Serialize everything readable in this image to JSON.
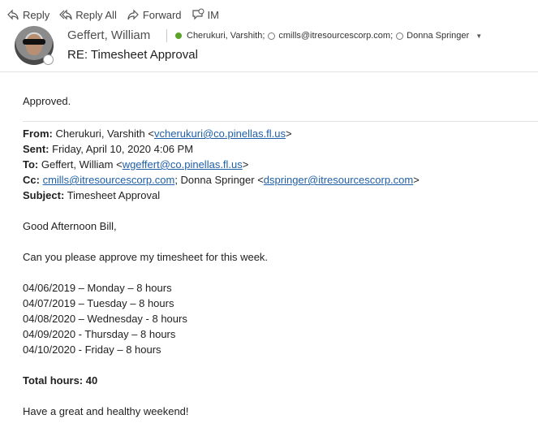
{
  "toolbar": {
    "reply": "Reply",
    "reply_all": "Reply All",
    "forward": "Forward",
    "im": "IM"
  },
  "header": {
    "sender_name": "Geffert, William",
    "subject": "RE: Timesheet Approval",
    "recipients": [
      {
        "name": "Cherukuri, Varshith;",
        "status": "online"
      },
      {
        "name": "cmills@itresourcescorp.com;",
        "status": "unknown"
      },
      {
        "name": "Donna Springer",
        "status": "unknown"
      }
    ]
  },
  "reply_text": "Approved.",
  "quoted": {
    "from_label": "From:",
    "from_name": "Cherukuri, Varshith <",
    "from_email": "vcherukuri@co.pinellas.fl.us",
    "from_end": ">",
    "sent_label": "Sent:",
    "sent_value": "Friday, April 10, 2020 4:06 PM",
    "to_label": "To:",
    "to_name": "Geffert, William <",
    "to_email": "wgeffert@co.pinellas.fl.us",
    "to_end": ">",
    "cc_label": "Cc:",
    "cc_email1": "cmills@itresourcescorp.com",
    "cc_mid": "; Donna Springer <",
    "cc_email2": "dspringer@itresourcescorp.com",
    "cc_end": ">",
    "subject_label": "Subject:",
    "subject_value": "Timesheet Approval"
  },
  "message": {
    "greeting": "Good Afternoon Bill,",
    "request": "Can you please approve my timesheet for this week.",
    "lines": [
      "04/06/2019 – Monday – 8 hours",
      "04/07/2019 – Tuesday – 8 hours",
      "04/08/2020 – Wednesday  - 8 hours",
      "04/09/2020 - Thursday – 8 hours",
      "04/10/2020 - Friday – 8 hours"
    ],
    "total": "Total hours: 40",
    "closing": "Have a great and healthy weekend!"
  }
}
